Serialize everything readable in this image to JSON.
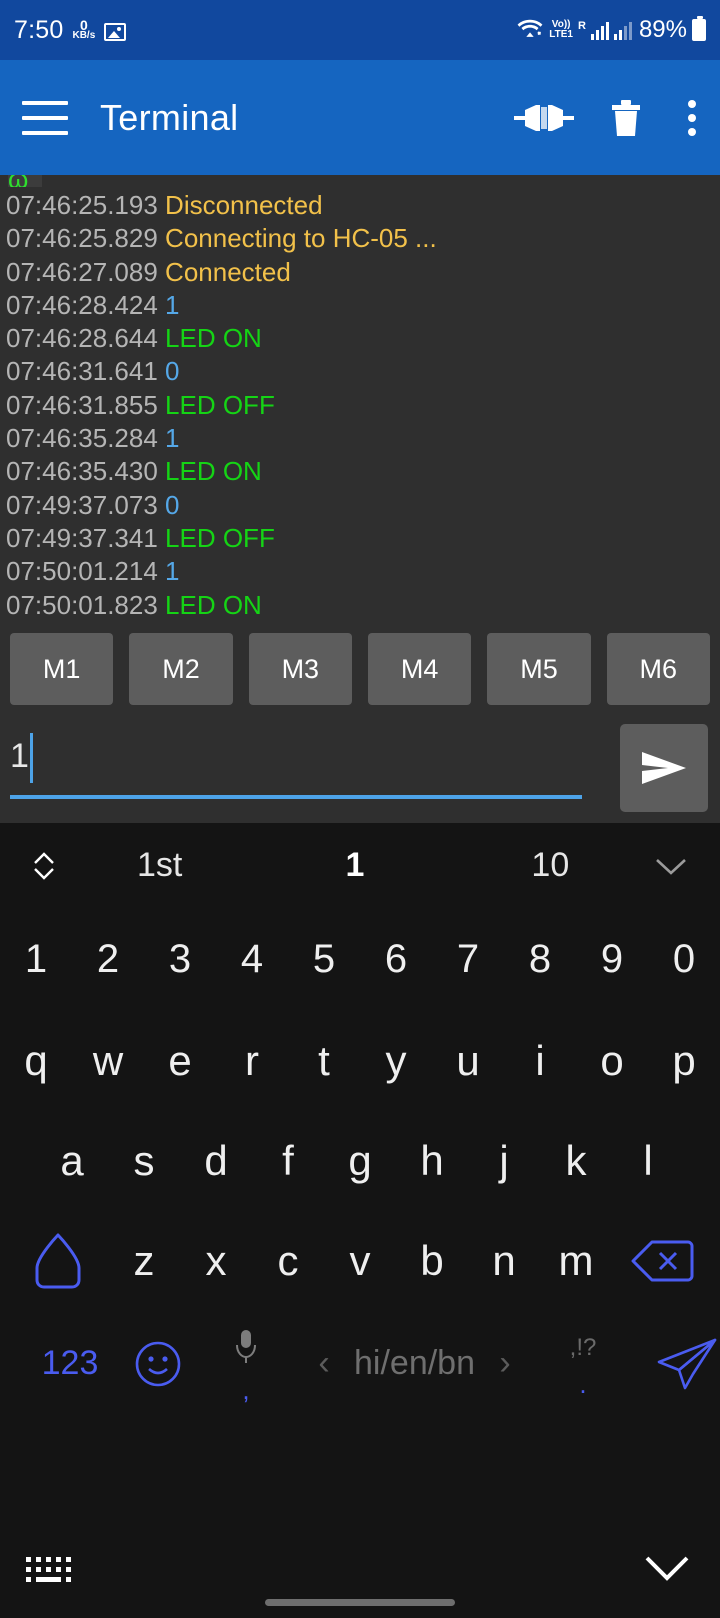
{
  "status_bar": {
    "clock": "7:50",
    "net_speed_value": "0",
    "net_speed_unit": "KB/s",
    "image_icon": "image-icon",
    "wifi_icon": "wifi-icon",
    "volte_top": "Vo))",
    "volte_bottom": "LTE1",
    "roaming": "R",
    "battery_percent": "89%",
    "battery_icon": "battery-icon"
  },
  "app_bar": {
    "menu_icon": "hamburger-menu-icon",
    "title": "Terminal",
    "connect_icon": "connector-plug-icon",
    "delete_icon": "trash-icon",
    "overflow_icon": "more-vertical-icon"
  },
  "terminal": {
    "partial_top_line": "ω",
    "lines": [
      {
        "time": "07:46:25.193",
        "text": "Disconnected",
        "kind": "status"
      },
      {
        "time": "07:46:25.829",
        "text": "Connecting to HC-05 ...",
        "kind": "status"
      },
      {
        "time": "07:46:27.089",
        "text": "Connected",
        "kind": "status"
      },
      {
        "time": "07:46:28.424",
        "text": "1",
        "kind": "tx"
      },
      {
        "time": "07:46:28.644",
        "text": "LED ON",
        "kind": "rx"
      },
      {
        "time": "07:46:31.641",
        "text": "0",
        "kind": "tx"
      },
      {
        "time": "07:46:31.855",
        "text": "LED OFF",
        "kind": "rx"
      },
      {
        "time": "07:46:35.284",
        "text": "1",
        "kind": "tx"
      },
      {
        "time": "07:46:35.430",
        "text": "LED ON",
        "kind": "rx"
      },
      {
        "time": "07:49:37.073",
        "text": "0",
        "kind": "tx"
      },
      {
        "time": "07:49:37.341",
        "text": "LED OFF",
        "kind": "rx"
      },
      {
        "time": "07:50:01.214",
        "text": "1",
        "kind": "tx"
      },
      {
        "time": "07:50:01.823",
        "text": "LED ON",
        "kind": "rx"
      }
    ],
    "colors": {
      "timestamp": "#b5b5b5",
      "status": "#f2c14a",
      "received": "#15d415",
      "sent": "#55a8e8",
      "background": "#2f2f2f"
    }
  },
  "macros": {
    "buttons": [
      "M1",
      "M2",
      "M3",
      "M4",
      "M5",
      "M6"
    ]
  },
  "send_row": {
    "input_value": "1",
    "input_placeholder": "",
    "send_icon": "send-arrow-icon",
    "underline_color": "#4da3e8"
  },
  "keyboard": {
    "suggestions": {
      "expand_arrows_icon": "expand-collapse-icon",
      "items": [
        {
          "label": "1st",
          "selected": false
        },
        {
          "label": "1",
          "selected": true
        },
        {
          "label": "10",
          "selected": false
        }
      ],
      "chevron_icon": "chevron-down-icon"
    },
    "row_numbers": [
      "1",
      "2",
      "3",
      "4",
      "5",
      "6",
      "7",
      "8",
      "9",
      "0"
    ],
    "row_one": [
      "q",
      "w",
      "e",
      "r",
      "t",
      "y",
      "u",
      "i",
      "o",
      "p"
    ],
    "row_two": [
      "a",
      "s",
      "d",
      "f",
      "g",
      "h",
      "j",
      "k",
      "l"
    ],
    "row_three": [
      "z",
      "x",
      "c",
      "v",
      "b",
      "n",
      "m"
    ],
    "shift_icon": "shift-key-icon",
    "backspace_icon": "backspace-icon",
    "bottom_row": {
      "numeric_label": "123",
      "emoji_icon": "emoji-smiley-icon",
      "mic_icon": "microphone-icon",
      "mic_sub_label": ",",
      "prev_lang_icon": "chevron-left-icon",
      "space_label": "hi/en/bn",
      "next_lang_icon": "chevron-right-icon",
      "punct_label": ",!?",
      "punct_sub_label": ".",
      "send_icon": "paper-plane-send-icon"
    },
    "accent_color": "#4a5cf0",
    "background": "#141414"
  },
  "nav_bar": {
    "keyboard_switch_icon": "keyboard-switch-icon",
    "hide_keyboard_icon": "chevron-down-hide-icon",
    "home_indicator": "home-indicator-bar"
  }
}
